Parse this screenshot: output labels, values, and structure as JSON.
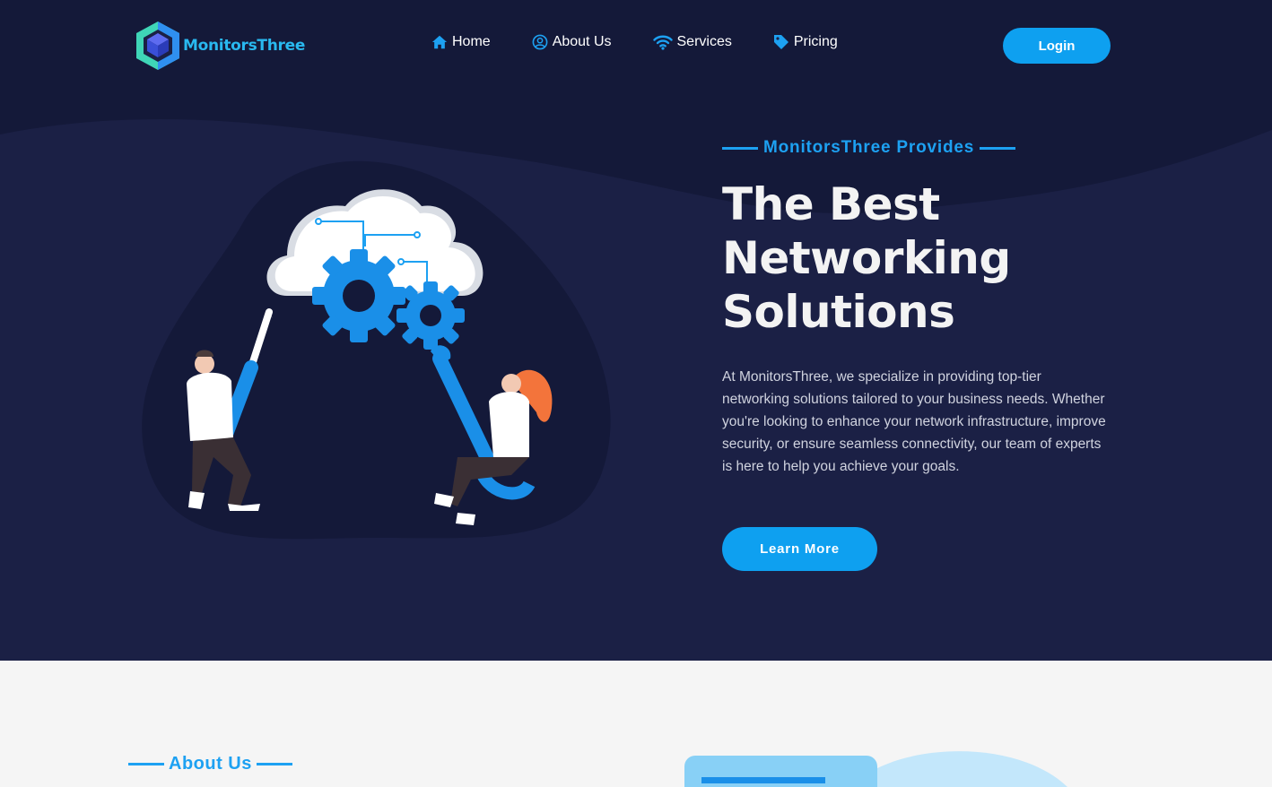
{
  "brand": {
    "name": "MonitorsThree",
    "accent": "#0ea0f0",
    "hero_bg": "#1b2045"
  },
  "nav": {
    "items": [
      {
        "label": "Home",
        "icon": "home-icon"
      },
      {
        "label": "About Us",
        "icon": "user-circle-icon"
      },
      {
        "label": "Services",
        "icon": "wifi-icon"
      },
      {
        "label": "Pricing",
        "icon": "tag-icon"
      }
    ],
    "login_label": "Login"
  },
  "hero": {
    "eyebrow": "MonitorsThree Provides",
    "headline_lines": [
      "The Best",
      "Networking",
      "Solutions"
    ],
    "description": "At MonitorsThree, we specialize in providing top-tier networking solutions tailored to your business needs. Whether you're looking to enhance your network infrastructure, improve security, or ensure seamless connectivity, our team of experts is here to help you achieve your goals.",
    "cta_label": "Learn More"
  },
  "about": {
    "eyebrow": "About Us"
  }
}
